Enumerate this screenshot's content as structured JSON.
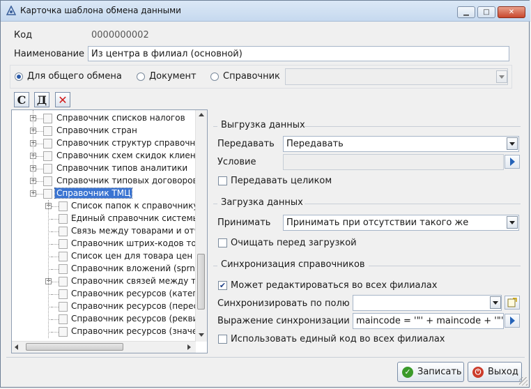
{
  "window": {
    "title": "Карточка шаблона обмена данными",
    "buttons": {
      "minimize": "▁",
      "maximize": "□",
      "close": "✕"
    }
  },
  "header": {
    "code_label": "Код",
    "code_value": "0000000002",
    "name_label": "Наименование",
    "name_value": "Из центра в филиал (основной)"
  },
  "exchange_type": {
    "options": [
      "Для общего обмена",
      "Документ",
      "Справочник"
    ],
    "selected": "Для общего обмена",
    "reference_value": ""
  },
  "tree_toolbar": {
    "create": "С",
    "delete": "Д",
    "remove": "✕"
  },
  "tree": {
    "items": [
      {
        "label": "Справочник списков  налогов"
      },
      {
        "label": "Справочник стран"
      },
      {
        "label": "Справочник структур справочников"
      },
      {
        "label": "Справочник схем скидок клиентам"
      },
      {
        "label": "Справочник типов аналитики"
      },
      {
        "label": "Справочник типовых договоров"
      },
      {
        "label": "Справочник ТМЦ"
      },
      {
        "label": "Список папок к справочнику структур"
      },
      {
        "label": "Единый справочник системы (sprnsi)"
      },
      {
        "label": "Связь между товарами и отчетными"
      },
      {
        "label": "Справочник штрих-кодов товаров"
      },
      {
        "label": "Список цен для товара цен может"
      },
      {
        "label": "Справочник вложений (sprnninsr)"
      },
      {
        "label": "Справочник связей между товарами"
      },
      {
        "label": "Справочник ресурсов (категории)"
      },
      {
        "label": "Справочник ресурсов (пересчет)"
      },
      {
        "label": "Справочник ресурсов (реквизиты)"
      },
      {
        "label": "Справочник ресурсов (значения)"
      }
    ],
    "selected": "Справочник ТМЦ"
  },
  "export": {
    "title": "Выгрузка данных",
    "transfer_label": "Передавать",
    "transfer_value": "Передавать",
    "condition_label": "Условие",
    "condition_value": "",
    "transfer_whole_label": "Передавать целиком",
    "transfer_whole_checked": false
  },
  "import": {
    "title": "Загрузка данных",
    "accept_label": "Принимать",
    "accept_value": "Принимать при отсутствии такого же",
    "clear_label": "Очищать перед загрузкой",
    "clear_checked": false
  },
  "sync": {
    "title": "Синхронизация справочников",
    "editable_label": "Может редактироваться во всех филиалах",
    "editable_checked": true,
    "field_label": "Синхронизировать по полю",
    "field_value": "",
    "expr_label": "Выражение синхронизации",
    "expr_value": "maincode = '\"' + maincode + '\"'",
    "single_code_label": "Использовать единый код во всех филиалах",
    "single_code_checked": false
  },
  "footer": {
    "save_label": "Записать",
    "exit_label": "Выход"
  },
  "colors": {
    "selection": "#3a74d2",
    "accent": "#2563b8"
  }
}
